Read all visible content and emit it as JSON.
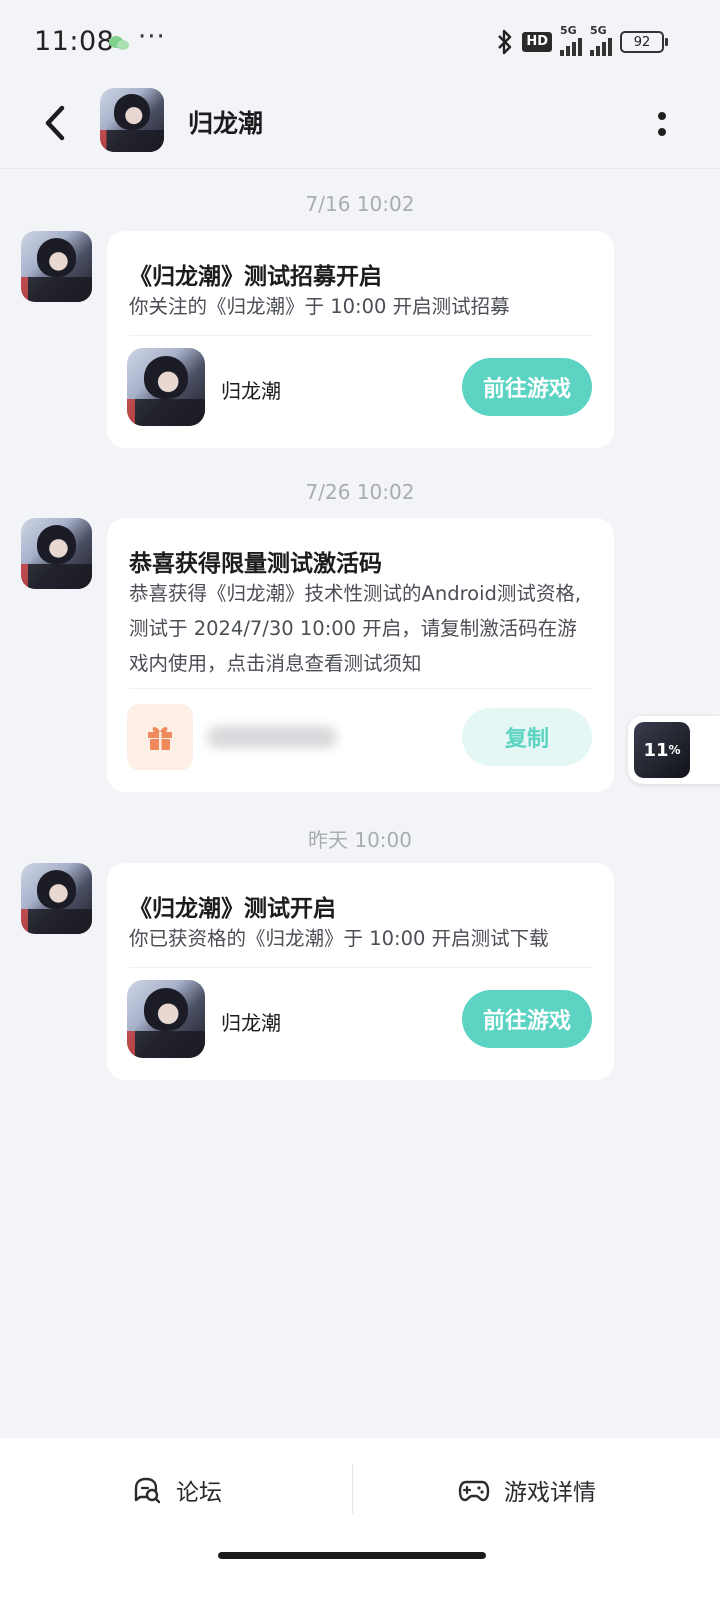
{
  "status_bar": {
    "time": "11:08",
    "more": "···",
    "hd_label": "HD",
    "net1": "5G",
    "net2": "5G",
    "battery": "92"
  },
  "header": {
    "title": "归龙潮"
  },
  "messages": [
    {
      "timestamp": "7/16  10:02",
      "title": "《归龙潮》测试招募开启",
      "body": "你关注的《归龙潮》于 10:00 开启测试招募",
      "game_name": "归龙潮",
      "action_label": "前往游戏"
    },
    {
      "timestamp": "7/26  10:02",
      "title": "恭喜获得限量测试激活码",
      "body": "恭喜获得《归龙潮》技术性测试的Android测试资格,测试于 2024/7/30 10:00 开启，请复制激活码在游戏内使用，点击消息查看测试须知",
      "action_label": "复制"
    },
    {
      "timestamp": "昨天  10:00",
      "title": "《归龙潮》测试开启",
      "body": "你已获资格的《归龙潮》于 10:00 开启测试下载",
      "game_name": "归龙潮",
      "action_label": "前往游戏"
    }
  ],
  "floating_widget": {
    "value": "11",
    "unit": "%"
  },
  "bottom_bar": {
    "forum_label": "论坛",
    "detail_label": "游戏详情"
  },
  "colors": {
    "accent": "#5dd4c3",
    "accent_light": "#e4f7f4",
    "background": "#f3f4f7",
    "gift": "#f08a5d"
  }
}
